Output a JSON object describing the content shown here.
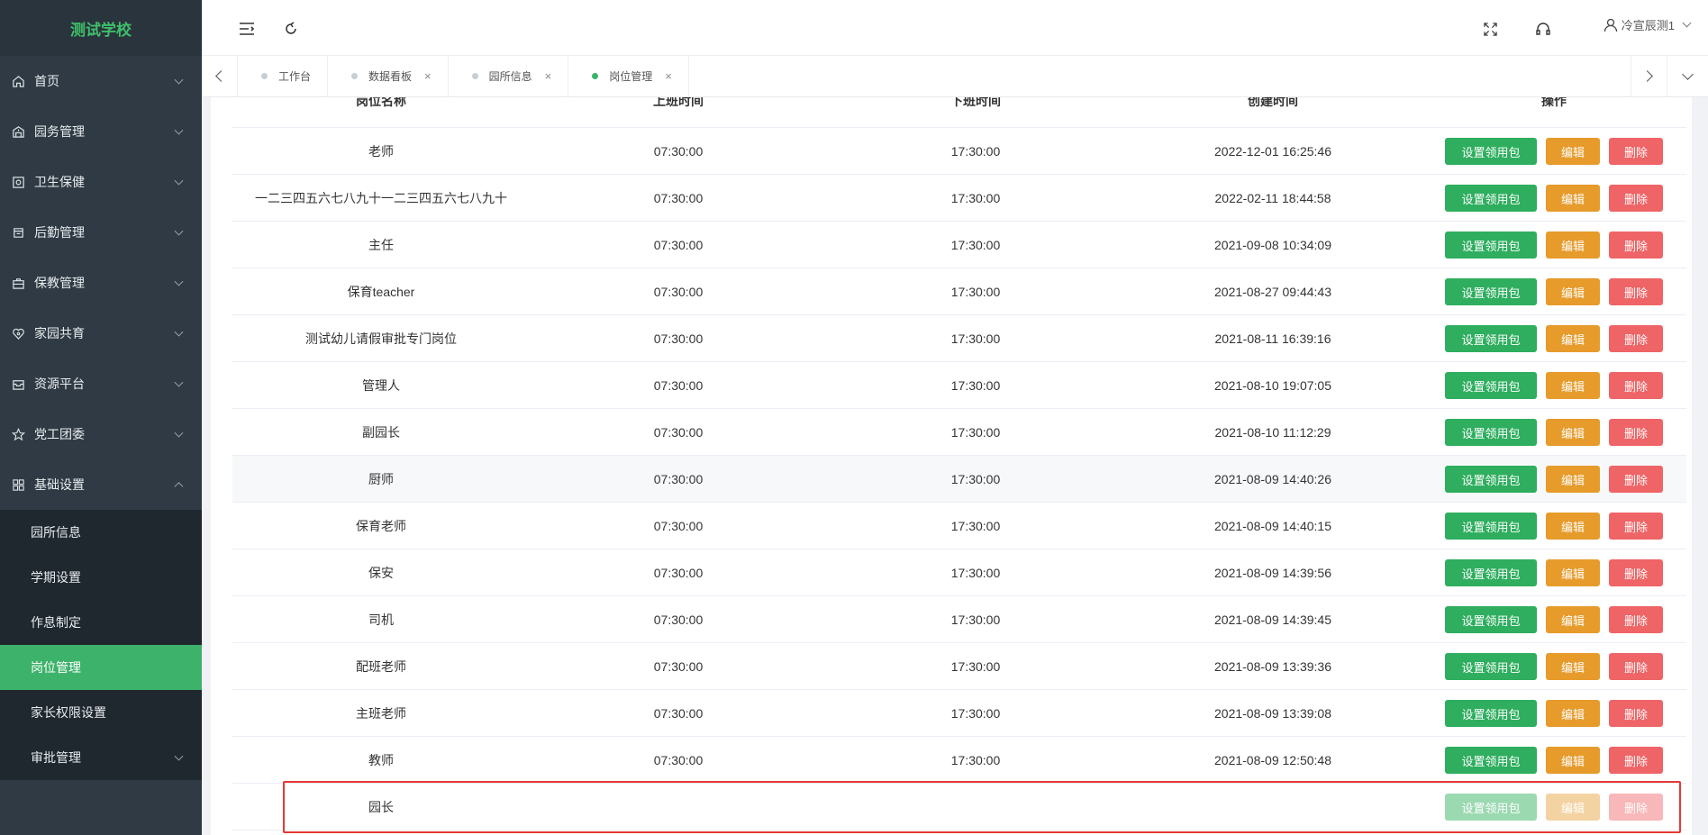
{
  "brand": "测试学校",
  "menu": [
    {
      "label": "首页",
      "icon": "home-icon"
    },
    {
      "label": "园务管理",
      "icon": "building-icon"
    },
    {
      "label": "卫生保健",
      "icon": "health-icon"
    },
    {
      "label": "后勤管理",
      "icon": "logistics-icon"
    },
    {
      "label": "保教管理",
      "icon": "briefcase-icon"
    },
    {
      "label": "家园共育",
      "icon": "heart-icon"
    },
    {
      "label": "资源平台",
      "icon": "inbox-icon"
    },
    {
      "label": "党工团委",
      "icon": "star-icon"
    },
    {
      "label": "基础设置",
      "icon": "grid-icon"
    }
  ],
  "submenu": [
    {
      "label": "园所信息"
    },
    {
      "label": "学期设置"
    },
    {
      "label": "作息制定"
    },
    {
      "label": "岗位管理"
    },
    {
      "label": "家长权限设置"
    },
    {
      "label": "审批管理"
    }
  ],
  "header": {
    "user_name": "冷宣辰测1"
  },
  "tabs": [
    {
      "label": "工作台",
      "closable": false
    },
    {
      "label": "数据看板",
      "closable": true
    },
    {
      "label": "园所信息",
      "closable": true
    },
    {
      "label": "岗位管理",
      "closable": true
    }
  ],
  "tab_close_glyph": "×",
  "table": {
    "columns": [
      "岗位名称",
      "上班时间",
      "下班时间",
      "创建时间",
      "操作"
    ],
    "actions": {
      "set_bag": "设置领用包",
      "edit": "编辑",
      "delete": "删除"
    },
    "rows": [
      {
        "name": "老师",
        "on": "07:30:00",
        "off": "17:30:00",
        "created": "2022-12-01 16:25:46"
      },
      {
        "name": "一二三四五六七八九十一二三四五六七八九十",
        "on": "07:30:00",
        "off": "17:30:00",
        "created": "2022-02-11 18:44:58"
      },
      {
        "name": "主任",
        "on": "07:30:00",
        "off": "17:30:00",
        "created": "2021-09-08 10:34:09"
      },
      {
        "name": "保育teacher",
        "on": "07:30:00",
        "off": "17:30:00",
        "created": "2021-08-27 09:44:43"
      },
      {
        "name": "测试幼儿请假审批专门岗位",
        "on": "07:30:00",
        "off": "17:30:00",
        "created": "2021-08-11 16:39:16"
      },
      {
        "name": "管理人",
        "on": "07:30:00",
        "off": "17:30:00",
        "created": "2021-08-10 19:07:05"
      },
      {
        "name": "副园长",
        "on": "07:30:00",
        "off": "17:30:00",
        "created": "2021-08-10 11:12:29"
      },
      {
        "name": "厨师",
        "on": "07:30:00",
        "off": "17:30:00",
        "created": "2021-08-09 14:40:26"
      },
      {
        "name": "保育老师",
        "on": "07:30:00",
        "off": "17:30:00",
        "created": "2021-08-09 14:40:15"
      },
      {
        "name": "保安",
        "on": "07:30:00",
        "off": "17:30:00",
        "created": "2021-08-09 14:39:56"
      },
      {
        "name": "司机",
        "on": "07:30:00",
        "off": "17:30:00",
        "created": "2021-08-09 14:39:45"
      },
      {
        "name": "配班老师",
        "on": "07:30:00",
        "off": "17:30:00",
        "created": "2021-08-09 13:39:36"
      },
      {
        "name": "主班老师",
        "on": "07:30:00",
        "off": "17:30:00",
        "created": "2021-08-09 13:39:08"
      },
      {
        "name": "教师",
        "on": "07:30:00",
        "off": "17:30:00",
        "created": "2021-08-09 12:50:48"
      },
      {
        "name": "园长",
        "on": "",
        "off": "",
        "created": "",
        "disabled": true
      }
    ]
  },
  "colors": {
    "sidebar_bg": "#2f3a44",
    "accent_green": "#3cb26b",
    "edit_orange": "#e69b2b",
    "delete_red": "#ef6466",
    "highlight_border": "#e53935"
  }
}
